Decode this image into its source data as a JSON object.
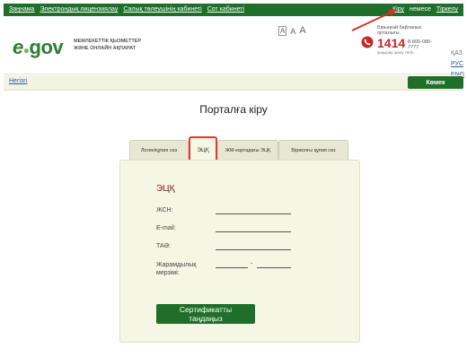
{
  "topbar": {
    "links": [
      "Заңнама",
      "Электрондық лицензиялау",
      "Салық төлеушінің кабинеті",
      "Сот кабинеті"
    ],
    "login": "Кіру",
    "or": "немесе",
    "register": "Тіркелу"
  },
  "header": {
    "logo_e": "e",
    "logo_dot": "●",
    "logo_gov": "gov",
    "subtitle_line1": "МЕМЛЕКЕТТІК ҚЫЗМЕТТЕР",
    "subtitle_line2": "ЖӘНЕ ОНЛАЙН АҚПАРАТ",
    "font_small": "A",
    "font_medium": "A",
    "font_large": "A",
    "callcenter_title": "Бірыңғай байланыс орталығы",
    "callcenter_number": "1414",
    "callcenter_alt": "8-800-080-7777",
    "callcenter_free": "қоңырау шалу тегін",
    "languages": [
      "ҚАЗ",
      "РУС",
      "ENG"
    ]
  },
  "navbar": {
    "home": "Негізгі",
    "help": "Көмек"
  },
  "page": {
    "title": "Порталға кіру"
  },
  "tabs": [
    "Логин/құпия сөз",
    "ЭЦҚ",
    "ЖМ-картадағы ЭЦҚ",
    "Біржолғы құпия сөз"
  ],
  "form": {
    "title": "ЭЦҚ",
    "fields": [
      "ЖСН:",
      "E-mail:",
      "ТАӘ:",
      "Жарамдылық мерзімі:"
    ],
    "validity_sep": "-",
    "button": "Сертификатты таңдаңыз"
  },
  "colors": {
    "brand_green": "#1f6f2a",
    "highlight_red": "#e53935",
    "panel_bg": "#f5f6e4"
  }
}
